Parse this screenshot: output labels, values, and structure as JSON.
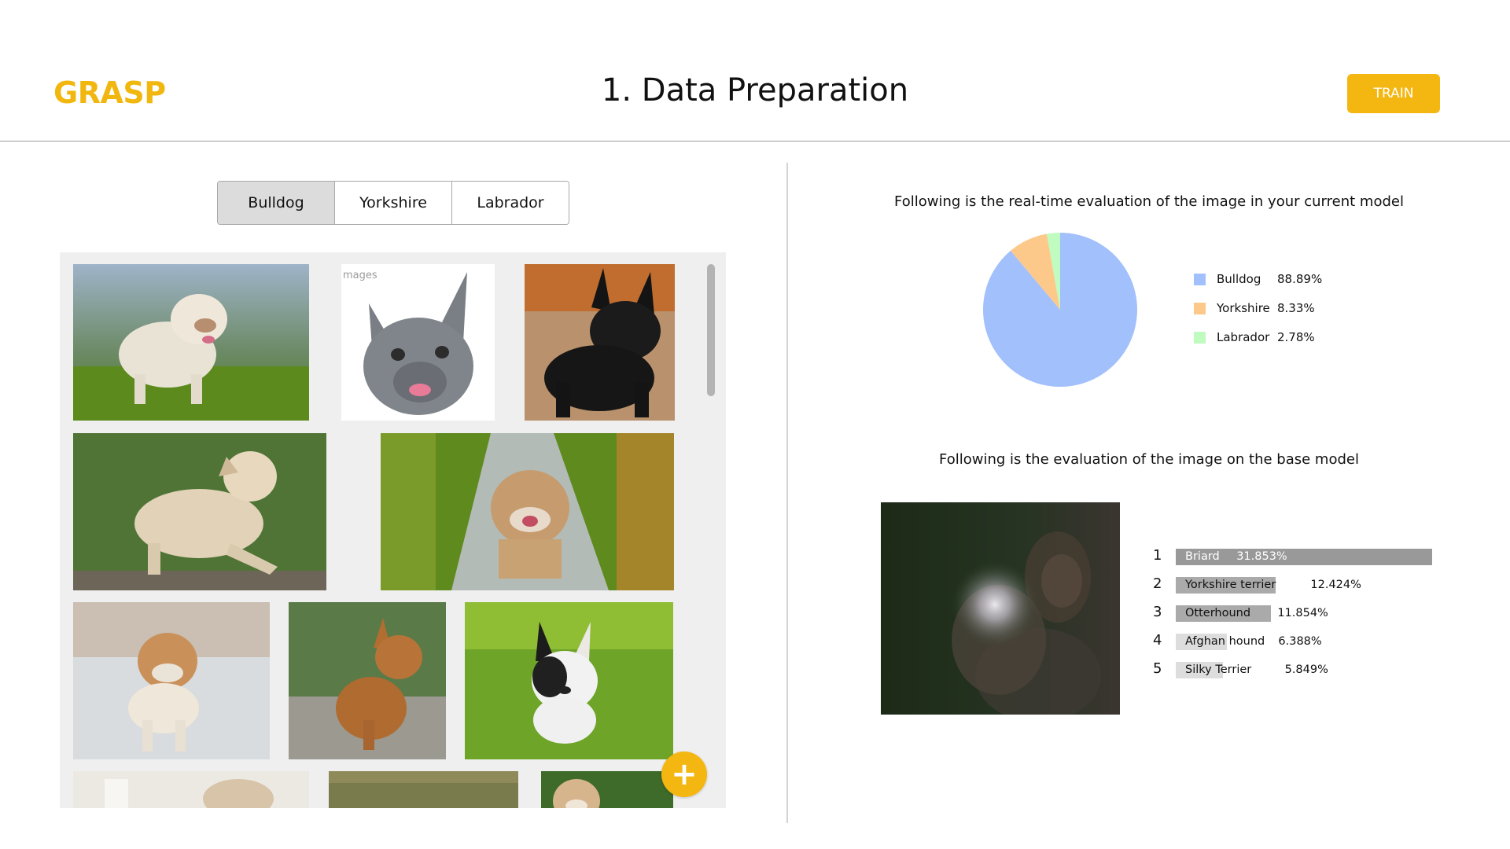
{
  "header": {
    "logo": "GRASP",
    "title": "1. Data Preparation",
    "train_label": "TRAIN"
  },
  "colors": {
    "accent": "#f4b711",
    "bulldog": "#a2c0fb",
    "yorkshire": "#fdc98a",
    "labrador": "#c0fbc0",
    "bar_dark": "#999999",
    "bar_light": "#dddddd"
  },
  "tabs": [
    {
      "label": "Bulldog",
      "active": true
    },
    {
      "label": "Yorkshire",
      "active": false
    },
    {
      "label": "Labrador",
      "active": false
    }
  ],
  "gallery": {
    "watermark_text": "mages"
  },
  "realtime": {
    "caption": "Following is the real-time evaluation of the image in your current model"
  },
  "base": {
    "caption": "Following is the evaluation of the image on the base model"
  },
  "chart_data": [
    {
      "type": "pie",
      "title": "",
      "categories": [
        "Bulldog",
        "Yorkshire",
        "Labrador"
      ],
      "values": [
        88.89,
        8.33,
        2.78
      ],
      "labels": [
        "88.89%",
        "8.33%",
        "2.78%"
      ],
      "colors": [
        "#a2c0fb",
        "#fdc98a",
        "#c0fbc0"
      ],
      "legend": "right"
    },
    {
      "type": "bar",
      "orientation": "horizontal",
      "title": "",
      "ranks": [
        "1",
        "2",
        "3",
        "4",
        "5"
      ],
      "categories": [
        "Briard",
        "Yorkshire terrier",
        "Otterhound",
        "Afghan hound",
        "Silky Terrier"
      ],
      "values": [
        31.853,
        12.424,
        11.854,
        6.388,
        5.849
      ],
      "labels": [
        "31.853%",
        "12.424%",
        "11.854%",
        "6.388%",
        "5.849%"
      ]
    }
  ]
}
